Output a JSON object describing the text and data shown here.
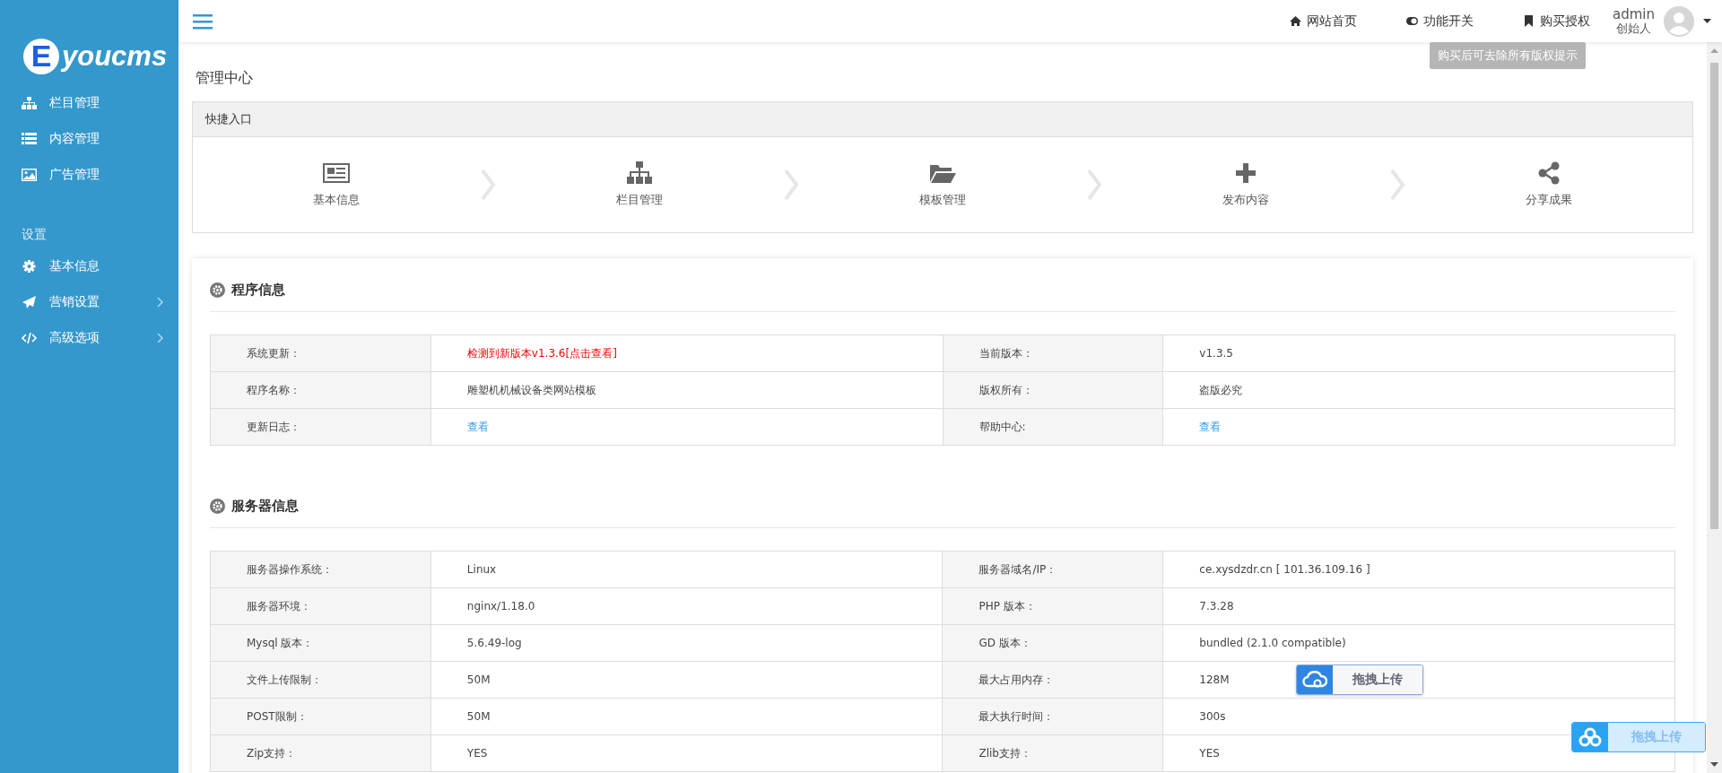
{
  "logo": {
    "letter": "E",
    "text": "youcms"
  },
  "sidebar": {
    "items": [
      {
        "label": "栏目管理",
        "expandable": false
      },
      {
        "label": "内容管理",
        "expandable": false
      },
      {
        "label": "广告管理",
        "expandable": false
      }
    ],
    "section_title": "设置",
    "settings_items": [
      {
        "label": "基本信息",
        "expandable": false
      },
      {
        "label": "营销设置",
        "expandable": true
      },
      {
        "label": "高级选项",
        "expandable": true
      }
    ]
  },
  "header": {
    "nav": [
      {
        "label": "网站首页"
      },
      {
        "label": "功能开关"
      },
      {
        "label": "购买授权"
      }
    ],
    "user": {
      "name": "admin",
      "role": "创始人"
    },
    "tooltip": "购买后可去除所有版权提示"
  },
  "page_title": "管理中心",
  "quick_entry": {
    "title": "快捷入口",
    "items": [
      {
        "label": "基本信息"
      },
      {
        "label": "栏目管理"
      },
      {
        "label": "模板管理"
      },
      {
        "label": "发布内容"
      },
      {
        "label": "分享成果"
      }
    ]
  },
  "sections": [
    {
      "title": "程序信息",
      "rows": [
        [
          {
            "label": "系统更新：",
            "value": "检测到新版本v1.3.6[点击查看]",
            "kind": "warning"
          },
          {
            "label": "当前版本：",
            "value": "v1.3.5",
            "kind": "text"
          }
        ],
        [
          {
            "label": "程序名称：",
            "value": "雕塑机机械设备类网站模板",
            "kind": "text"
          },
          {
            "label": "版权所有：",
            "value": "盗版必究",
            "kind": "text"
          }
        ],
        [
          {
            "label": "更新日志：",
            "value": "查看",
            "kind": "link"
          },
          {
            "label": "帮助中心:",
            "value": "查看",
            "kind": "link"
          }
        ]
      ]
    },
    {
      "title": "服务器信息",
      "rows": [
        [
          {
            "label": "服务器操作系统：",
            "value": "Linux",
            "kind": "text"
          },
          {
            "label": "服务器域名/IP：",
            "value": "ce.xysdzdr.cn [ 101.36.109.16 ]",
            "kind": "text"
          }
        ],
        [
          {
            "label": "服务器环境：",
            "value": "nginx/1.18.0",
            "kind": "text"
          },
          {
            "label": "PHP 版本：",
            "value": "7.3.28",
            "kind": "text"
          }
        ],
        [
          {
            "label": "Mysql 版本：",
            "value": "5.6.49-log",
            "kind": "text"
          },
          {
            "label": "GD 版本：",
            "value": "bundled (2.1.0 compatible)",
            "kind": "text"
          }
        ],
        [
          {
            "label": "文件上传限制：",
            "value": "50M",
            "kind": "text"
          },
          {
            "label": "最大占用内存：",
            "value": "128M",
            "kind": "text"
          }
        ],
        [
          {
            "label": "POST限制：",
            "value": "50M",
            "kind": "text"
          },
          {
            "label": "最大执行时间：",
            "value": "300s",
            "kind": "text"
          }
        ],
        [
          {
            "label": "Zip支持：",
            "value": "YES",
            "kind": "text"
          },
          {
            "label": "Zlib支持：",
            "value": "YES",
            "kind": "text"
          }
        ]
      ]
    }
  ],
  "upload_button": {
    "label": "拖拽上传"
  },
  "floating_upload_button": {
    "label": "拖拽上传"
  }
}
